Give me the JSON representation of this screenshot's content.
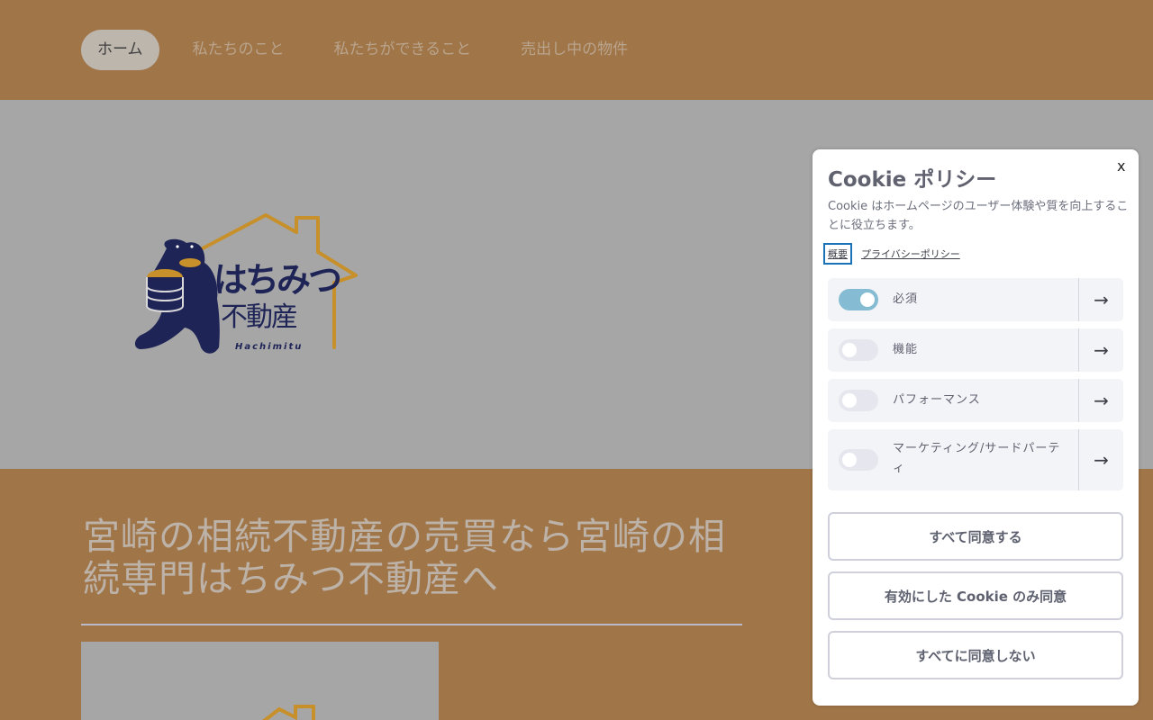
{
  "nav": {
    "items": [
      {
        "label": "ホーム",
        "active": true
      },
      {
        "label": "私たちのこと",
        "active": false
      },
      {
        "label": "私たちができること",
        "active": false
      },
      {
        "label": "売出し中の物件",
        "active": false
      }
    ]
  },
  "logo": {
    "text_main": "はちみつ",
    "text_sub": "不動産",
    "text_roman": "Hachimitu",
    "icon": "bear-carrying-honey-pot-with-house-outline-logo"
  },
  "main": {
    "headline": "宮崎の相続不動産の売買なら宮崎の相続専門はちみつ不動産へ"
  },
  "cookie": {
    "title": "Cookie ポリシー",
    "close_label": "x",
    "description": "Cookie はホームページのユーザー体験や質を向上することに役立ちます。",
    "links": {
      "summary": "概要",
      "privacy": "プライバシーポリシー"
    },
    "categories": [
      {
        "label": "必須",
        "enabled": true
      },
      {
        "label": "機能",
        "enabled": false
      },
      {
        "label": "パフォーマンス",
        "enabled": false
      },
      {
        "label": "マーケティング/サードパーティ",
        "enabled": false
      }
    ],
    "buttons": {
      "accept_all": "すべて同意する",
      "accept_selected": "有効にした Cookie のみ同意",
      "reject_all": "すべてに同意しない"
    }
  },
  "colors": {
    "brand_brown": "#a07548",
    "hero_gray": "#a6a6a6",
    "toggle_on": "#85bcd3",
    "logo_navy": "#1f2457",
    "logo_gold": "#c7902a"
  }
}
